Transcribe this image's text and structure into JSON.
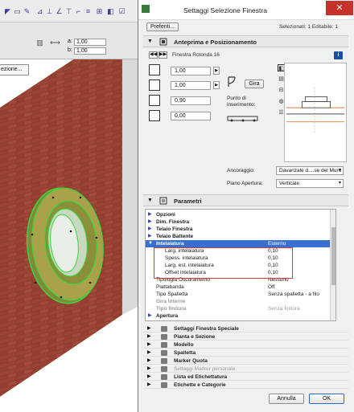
{
  "toolbar": {
    "selection_button": "ezione...",
    "a_label": "a:",
    "a_value": "1,00",
    "b_label": "b:",
    "b_value": "1,00"
  },
  "dialog": {
    "title": "Settaggi Selezione Finestra",
    "favorites_button": "Preferiti...",
    "selection_info": "Selezionati: 1 Editabile: 1",
    "close_symbol": "✕"
  },
  "preview": {
    "header": "Anteprima e Posizionamento",
    "window_name": "Finestra Rotonda 16",
    "info_symbol": "i",
    "width": "1,00",
    "height": "1,00",
    "sill": "0,90",
    "offset": "0,00",
    "rotate_button": "Gira",
    "insertion_point_label": "Punto di\ninserimento:",
    "anchor_label": "Ancoraggio:",
    "anchor_value": "Davanzale d....se del Muro",
    "opening_label": "Piano Apertura:",
    "opening_value": "Verticale"
  },
  "parameters": {
    "header": "Parametri",
    "rows": [
      {
        "name": "Opzioni",
        "value": "",
        "kind": "group"
      },
      {
        "name": "Dim. Finestra",
        "value": "",
        "kind": "group"
      },
      {
        "name": "Telaio Finestra",
        "value": "",
        "kind": "group"
      },
      {
        "name": "Telaio Battente",
        "value": "",
        "kind": "group"
      },
      {
        "name": "Intelaiatura",
        "value": "Esterno",
        "kind": "selected"
      },
      {
        "name": "Larg. intelaiatura",
        "value": "0,10",
        "kind": "child"
      },
      {
        "name": "Spess. intelaiatura",
        "value": "0,10",
        "kind": "child"
      },
      {
        "name": "Larg. est. intelaiatura",
        "value": "0,10",
        "kind": "child"
      },
      {
        "name": "Offset intelaiatura",
        "value": "0,10",
        "kind": "child"
      },
      {
        "name": "Tipologia Oscuramento",
        "value": "Nessuno",
        "kind": "plain"
      },
      {
        "name": "Piattabanda",
        "value": "Off",
        "kind": "plain"
      },
      {
        "name": "Tipo Spalletta",
        "value": "Senza spalletta - a filo",
        "kind": "plain"
      },
      {
        "name": "Gira Interne",
        "value": "",
        "kind": "dim"
      },
      {
        "name": "Tipo finitura",
        "value": "Senza finitura",
        "kind": "dim"
      },
      {
        "name": "Apertura",
        "value": "",
        "kind": "group"
      }
    ]
  },
  "categories": [
    {
      "label": "Settaggi Finestra Speciale",
      "dim": false
    },
    {
      "label": "Pianta e Sezione",
      "dim": false
    },
    {
      "label": "Modello",
      "dim": false
    },
    {
      "label": "Spalletta",
      "dim": false
    },
    {
      "label": "Marker Quota",
      "dim": false
    },
    {
      "label": "Settaggi Marker personale",
      "dim": true
    },
    {
      "label": "Lista ed Etichettatura",
      "dim": false
    },
    {
      "label": "Etichette e Categorie",
      "dim": false
    }
  ],
  "buttons": {
    "cancel": "Annulla",
    "ok": "OK"
  },
  "colors": {
    "frame_green": "#8a9a3a",
    "selection_outline": "#3ad93a",
    "brick": "#8a3a30",
    "selected_row": "#3a6fd0",
    "highlight_box": "#d23a3a"
  }
}
